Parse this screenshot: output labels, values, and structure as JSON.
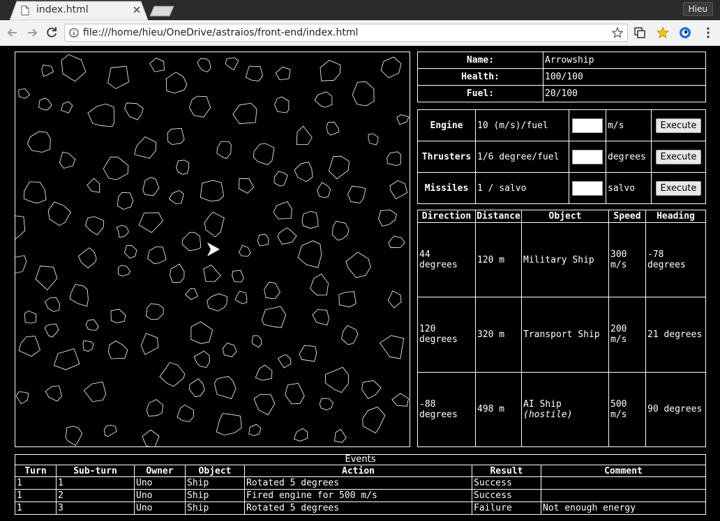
{
  "browser": {
    "tab_title": "index.html",
    "url": "file:///home/hieu/OneDrive/astraios/front-end/index.html",
    "profile_name": "Hieu"
  },
  "ship": {
    "name_label": "Name:",
    "name": "Arrowship",
    "health_label": "Health:",
    "health": "100/100",
    "fuel_label": "Fuel:",
    "fuel": "20/100"
  },
  "controls": [
    {
      "label": "Engine",
      "rate": "10 (m/s)/fuel",
      "unit": "m/s",
      "button": "Execute"
    },
    {
      "label": "Thrusters",
      "rate": "1/6 degree/fuel",
      "unit": "degrees",
      "button": "Execute"
    },
    {
      "label": "Missiles",
      "rate": "1 / salvo",
      "unit": "salvo",
      "button": "Execute"
    }
  ],
  "radar": {
    "headers": [
      "Direction",
      "Distance",
      "Object",
      "Speed",
      "Heading"
    ],
    "rows": [
      {
        "direction": "44 degrees",
        "distance": "120 m",
        "object": "Military Ship",
        "object_note": "",
        "speed": "300 m/s",
        "heading": "-78 degrees"
      },
      {
        "direction": "120 degrees",
        "distance": "320 m",
        "object": "Transport Ship",
        "object_note": "",
        "speed": "200 m/s",
        "heading": "21 degrees"
      },
      {
        "direction": "-88 degrees",
        "distance": "498 m",
        "object": "AI Ship",
        "object_note": "(hostile)",
        "speed": "500 m/s",
        "heading": "90 degrees"
      }
    ]
  },
  "events": {
    "caption": "Events",
    "headers": [
      "Turn",
      "Sub-turn",
      "Owner",
      "Object",
      "Action",
      "Result",
      "Comment"
    ],
    "rows": [
      [
        "1",
        "1",
        "Uno",
        "Ship",
        "Rotated 5 degrees",
        "Success",
        ""
      ],
      [
        "1",
        "2",
        "Uno",
        "Ship",
        "Fired engine for 500 m/s",
        "Success",
        ""
      ],
      [
        "1",
        "3",
        "Uno",
        "Ship",
        "Rotated 5 degrees",
        "Failure",
        "Not enough energy"
      ]
    ]
  },
  "colors": {
    "background": "#000000",
    "foreground": "#ffffff",
    "asteroid_stroke": "#ffffff",
    "ship_fill": "#ffffff"
  }
}
